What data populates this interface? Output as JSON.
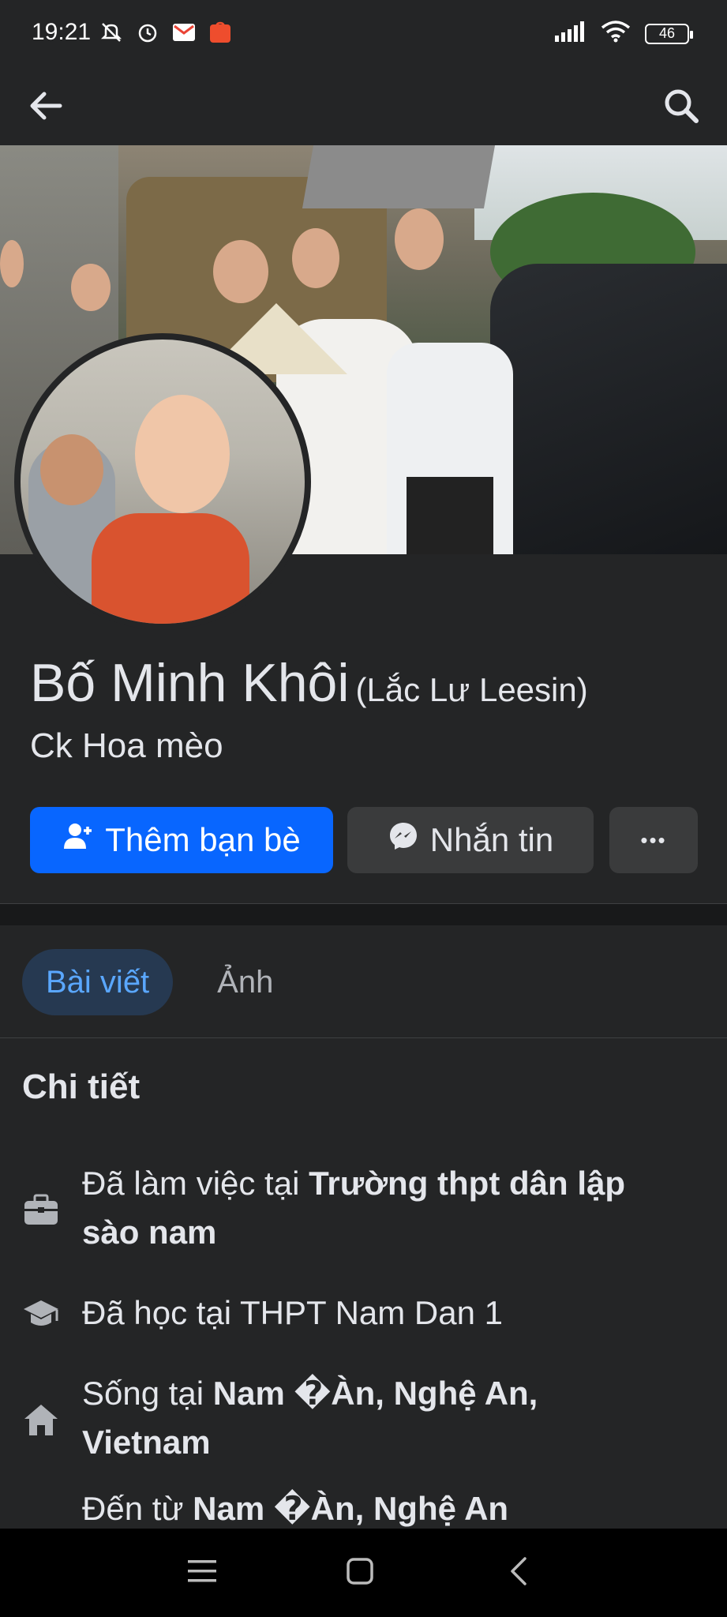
{
  "status_bar": {
    "time": "19:21",
    "battery": "46",
    "icons_left": [
      "mute-icon",
      "alarm-icon",
      "gmail-icon",
      "shopee-icon"
    ],
    "icons_right": [
      "signal-icon",
      "wifi-icon",
      "battery-icon"
    ]
  },
  "header": {
    "back_icon": "arrow-left-icon",
    "search_icon": "search-icon"
  },
  "profile": {
    "name": "Bố Minh Khôi",
    "alt_name": "(Lắc Lư Leesin)",
    "bio": "Ck Hoa mèo"
  },
  "actions": {
    "add_friend": "Thêm bạn bè",
    "message": "Nhắn tin",
    "more": "•••"
  },
  "tabs": [
    {
      "label": "Bài viết",
      "active": true
    },
    {
      "label": "Ảnh",
      "active": false
    }
  ],
  "details": {
    "title": "Chi tiết",
    "items": [
      {
        "icon": "briefcase-icon",
        "prefix": "Đã làm việc tại ",
        "bold": "Trường thpt dân lập sào nam"
      },
      {
        "icon": "graduation-cap-icon",
        "prefix": "Đã học tại THPT Nam Dan 1",
        "bold": ""
      },
      {
        "icon": "home-icon",
        "prefix": "Sống tại ",
        "bold": "Nam �Àn, Nghệ An, Vietnam"
      },
      {
        "icon": "location-pin-icon",
        "prefix": "Đến từ ",
        "bold": "Nam �Àn, Nghệ An"
      }
    ]
  },
  "colors": {
    "background": "#242526",
    "primary_button": "#0866ff",
    "secondary_button": "#3a3b3c",
    "tab_active_bg": "#263951",
    "tab_active_text": "#5aa7ff"
  }
}
